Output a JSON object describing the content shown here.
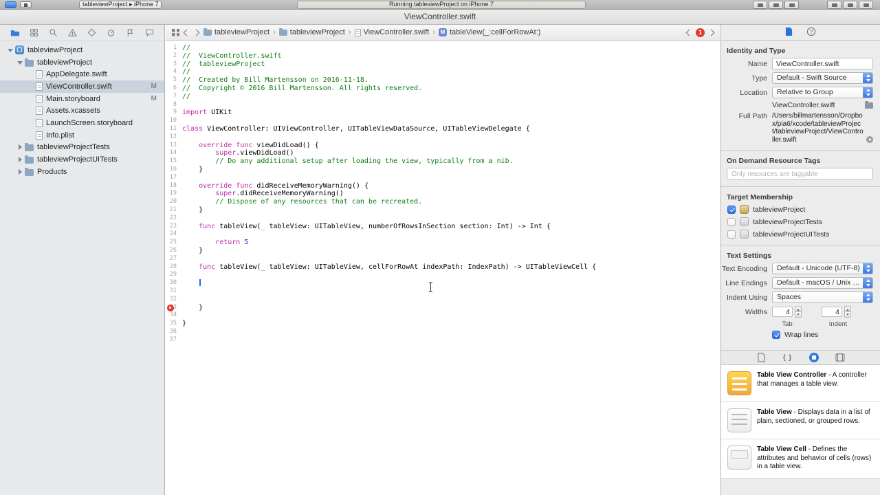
{
  "toolbar": {
    "scheme_text": "tableviewProject ▸ iPhone 7",
    "status_text": "Running tableviewProject on iPhone 7"
  },
  "titlebar": {
    "title": "ViewController.swift"
  },
  "navigator": {
    "items": [
      {
        "label": "tableviewProject",
        "type": "project",
        "level": 0,
        "disclosure": "open",
        "selected": false
      },
      {
        "label": "tableviewProject",
        "type": "folder",
        "level": 1,
        "disclosure": "open",
        "selected": false
      },
      {
        "label": "AppDelegate.swift",
        "type": "swift",
        "level": 2,
        "selected": false
      },
      {
        "label": "ViewController.swift",
        "type": "swift",
        "level": 2,
        "selected": true,
        "badge": "M"
      },
      {
        "label": "Main.storyboard",
        "type": "storyboard",
        "level": 2,
        "selected": false,
        "badge": "M"
      },
      {
        "label": "Assets.xcassets",
        "type": "assets",
        "level": 2,
        "selected": false
      },
      {
        "label": "LaunchScreen.storyboard",
        "type": "storyboard",
        "level": 2,
        "selected": false
      },
      {
        "label": "Info.plist",
        "type": "plist",
        "level": 2,
        "selected": false
      },
      {
        "label": "tableviewProjectTests",
        "type": "folder",
        "level": 1,
        "disclosure": "closed",
        "selected": false
      },
      {
        "label": "tableviewProjectUITests",
        "type": "folder",
        "level": 1,
        "disclosure": "closed",
        "selected": false
      },
      {
        "label": "Products",
        "type": "folder",
        "level": 1,
        "disclosure": "closed",
        "selected": false
      }
    ]
  },
  "jumpbar": {
    "separator": "›",
    "method_icon_letter": "M",
    "issue_count": "1",
    "crumbs": [
      {
        "label": "tableviewProject",
        "icon": "folder"
      },
      {
        "label": "tableviewProject",
        "icon": "folder"
      },
      {
        "label": "ViewController.swift",
        "icon": "swift"
      },
      {
        "label": "tableView(_:cellForRowAt:)",
        "icon": "method"
      }
    ]
  },
  "editor": {
    "lines": [
      {
        "n": 1,
        "s": [
          [
            "//",
            "c"
          ]
        ]
      },
      {
        "n": 2,
        "s": [
          [
            "//  ViewController.swift",
            "c"
          ]
        ]
      },
      {
        "n": 3,
        "s": [
          [
            "//  tableviewProject",
            "c"
          ]
        ]
      },
      {
        "n": 4,
        "s": [
          [
            "//",
            "c"
          ]
        ]
      },
      {
        "n": 5,
        "s": [
          [
            "//  Created by Bill Martensson on 2016-11-18.",
            "c"
          ]
        ]
      },
      {
        "n": 6,
        "s": [
          [
            "//  Copyright © 2016 Bill Martensson. All rights reserved.",
            "c"
          ]
        ]
      },
      {
        "n": 7,
        "s": [
          [
            "//",
            "c"
          ]
        ]
      },
      {
        "n": 8,
        "s": []
      },
      {
        "n": 9,
        "s": [
          [
            "import",
            "k"
          ],
          [
            " UIKit",
            "p"
          ]
        ]
      },
      {
        "n": 10,
        "s": []
      },
      {
        "n": 11,
        "s": [
          [
            "class",
            "k"
          ],
          [
            " ViewController: UIViewController, UITableViewDataSource, UITableViewDelegate {",
            "p"
          ]
        ]
      },
      {
        "n": 12,
        "s": []
      },
      {
        "n": 13,
        "s": [
          [
            "    ",
            "p"
          ],
          [
            "override",
            "k"
          ],
          [
            " ",
            "p"
          ],
          [
            "func",
            "k"
          ],
          [
            " viewDidLoad() {",
            "p"
          ]
        ]
      },
      {
        "n": 14,
        "s": [
          [
            "        ",
            "p"
          ],
          [
            "super",
            "k"
          ],
          [
            ".viewDidLoad()",
            "p"
          ]
        ]
      },
      {
        "n": 15,
        "s": [
          [
            "        ",
            "p"
          ],
          [
            "// Do any additional setup after loading the view, typically from a nib.",
            "c"
          ]
        ]
      },
      {
        "n": 16,
        "s": [
          [
            "    }",
            "p"
          ]
        ]
      },
      {
        "n": 17,
        "s": []
      },
      {
        "n": 18,
        "s": [
          [
            "    ",
            "p"
          ],
          [
            "override",
            "k"
          ],
          [
            " ",
            "p"
          ],
          [
            "func",
            "k"
          ],
          [
            " didReceiveMemoryWarning() {",
            "p"
          ]
        ]
      },
      {
        "n": 19,
        "s": [
          [
            "        ",
            "p"
          ],
          [
            "super",
            "k"
          ],
          [
            ".didReceiveMemoryWarning()",
            "p"
          ]
        ]
      },
      {
        "n": 20,
        "s": [
          [
            "        ",
            "p"
          ],
          [
            "// Dispose of any resources that can be recreated.",
            "c"
          ]
        ]
      },
      {
        "n": 21,
        "s": [
          [
            "    }",
            "p"
          ]
        ]
      },
      {
        "n": 22,
        "s": []
      },
      {
        "n": 23,
        "s": [
          [
            "    ",
            "p"
          ],
          [
            "func",
            "k"
          ],
          [
            " tableView(",
            "p"
          ],
          [
            "_",
            "k"
          ],
          [
            " tableView: UITableView, numberOfRowsInSection section: Int) -> Int {",
            "p"
          ]
        ]
      },
      {
        "n": 24,
        "s": []
      },
      {
        "n": 25,
        "s": [
          [
            "        ",
            "p"
          ],
          [
            "return",
            "k"
          ],
          [
            " ",
            "p"
          ],
          [
            "5",
            "n"
          ]
        ]
      },
      {
        "n": 26,
        "s": [
          [
            "    }",
            "p"
          ]
        ]
      },
      {
        "n": 27,
        "s": []
      },
      {
        "n": 28,
        "s": [
          [
            "    ",
            "p"
          ],
          [
            "func",
            "k"
          ],
          [
            " tableView(",
            "p"
          ],
          [
            "_",
            "k"
          ],
          [
            " tableView: UITableView, cellForRowAt indexPath: IndexPath) -> UITableViewCell {",
            "p"
          ]
        ]
      },
      {
        "n": 29,
        "s": []
      },
      {
        "n": 30,
        "s": [],
        "caret": true
      },
      {
        "n": 31,
        "s": []
      },
      {
        "n": 32,
        "s": []
      },
      {
        "n": 33,
        "s": [
          [
            "    }",
            "p"
          ]
        ],
        "err": true
      },
      {
        "n": 34,
        "s": []
      },
      {
        "n": 35,
        "s": [
          [
            "}",
            "p"
          ]
        ]
      },
      {
        "n": 36,
        "s": []
      },
      {
        "n": 37,
        "s": []
      }
    ]
  },
  "inspector": {
    "identity_header": "Identity and Type",
    "name_label": "Name",
    "name_value": "ViewController.swift",
    "type_label": "Type",
    "type_value": "Default - Swift Source",
    "location_label": "Location",
    "location_value": "Relative to Group",
    "file_name": "ViewController.swift",
    "full_path_label": "Full Path",
    "full_path": "/Users/billmartensson/Dropbox/pia6/xcode/tableviewProject/tableviewProject/ViewController.swift",
    "odr_header": "On Demand Resource Tags",
    "odr_placeholder": "Only resources are taggable",
    "target_header": "Target Membership",
    "targets": [
      {
        "label": "tableviewProject",
        "checked": true,
        "icon": "app"
      },
      {
        "label": "tableviewProjectTests",
        "checked": false,
        "icon": "test"
      },
      {
        "label": "tableviewProjectUITests",
        "checked": false,
        "icon": "test"
      }
    ],
    "text_settings_header": "Text Settings",
    "encoding_label": "Text Encoding",
    "encoding_value": "Default - Unicode (UTF-8)",
    "line_endings_label": "Line Endings",
    "line_endings_value": "Default - macOS / Unix (LF)",
    "indent_label": "Indent Using",
    "indent_value": "Spaces",
    "widths_label": "Widths",
    "tab_width": "4",
    "indent_width": "4",
    "tab_caption": "Tab",
    "indent_caption": "Indent",
    "wrap_label": "Wrap lines"
  },
  "library": {
    "items": [
      {
        "name": "Table View Controller",
        "desc": "A controller that manages a table view.",
        "icon": "tvc"
      },
      {
        "name": "Table View",
        "desc": "Displays data in a list of plain, sectioned, or grouped rows.",
        "icon": "tv"
      },
      {
        "name": "Table View Cell",
        "desc": "Defines the attributes and behavior of cells (rows) in a table view.",
        "icon": "tvcell"
      }
    ]
  }
}
